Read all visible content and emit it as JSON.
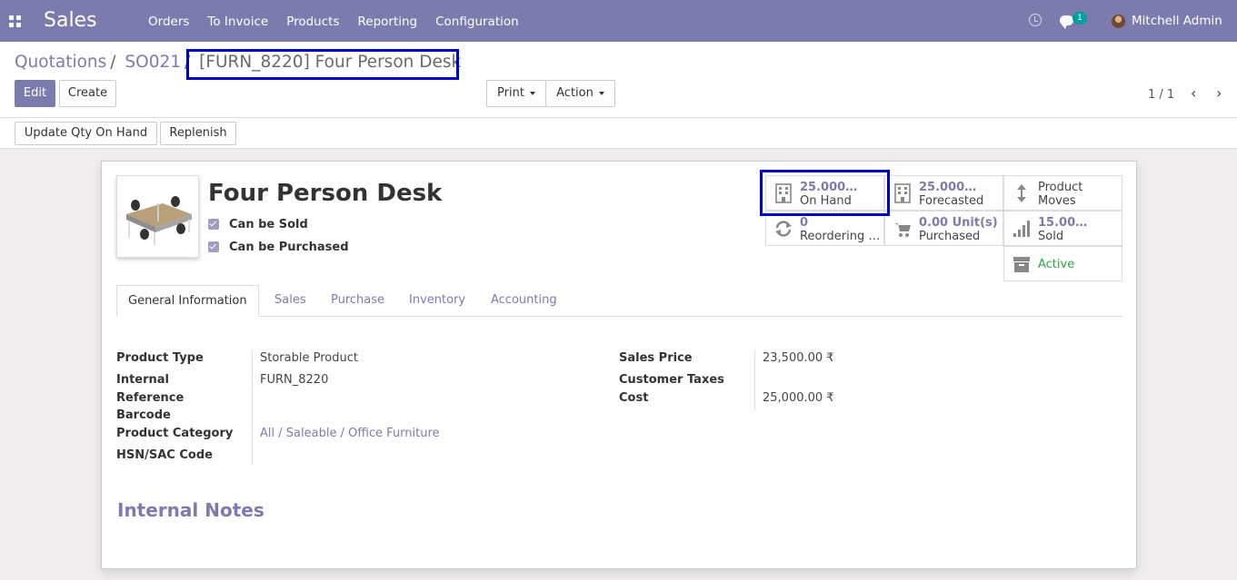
{
  "navbar": {
    "app_name": "Sales",
    "menu": [
      "Orders",
      "To Invoice",
      "Products",
      "Reporting",
      "Configuration"
    ],
    "chat_badge": "1",
    "user": "Mitchell Admin",
    "bg_color": "#7c7bad"
  },
  "breadcrumb": {
    "items": [
      "Quotations",
      "SO021"
    ],
    "current": "[FURN_8220] Four Person Desk"
  },
  "toolbar": {
    "edit_label": "Edit",
    "create_label": "Create",
    "print_label": "Print",
    "action_label": "Action",
    "pager": "1 / 1"
  },
  "statusbar": {
    "update_qty_label": "Update Qty On Hand",
    "replenish_label": "Replenish"
  },
  "product": {
    "name": "Four Person Desk",
    "can_be_sold_label": "Can be Sold",
    "can_be_purchased_label": "Can be Purchased",
    "can_be_sold": true,
    "can_be_purchased": true
  },
  "smart_buttons": {
    "on_hand": {
      "value": "25.000…",
      "label": "On Hand"
    },
    "forecasted": {
      "value": "25.000…",
      "label": "Forecasted"
    },
    "moves": {
      "line1": "Product",
      "line2": "Moves"
    },
    "reordering": {
      "value": "0",
      "label": "Reordering …"
    },
    "purchased": {
      "value": "0.00 Unit(s)",
      "label": "Purchased"
    },
    "sold": {
      "value": "15.00…",
      "label": "Sold"
    },
    "active": {
      "label": "Active"
    }
  },
  "tabs": [
    "General Information",
    "Sales",
    "Purchase",
    "Inventory",
    "Accounting"
  ],
  "general": {
    "product_type_label": "Product Type",
    "product_type": "Storable Product",
    "internal_ref_label_1": "Internal",
    "internal_ref_label_2": "Reference",
    "internal_ref": "FURN_8220",
    "barcode_label": "Barcode",
    "category_label": "Product Category",
    "category": [
      "All",
      "Saleable",
      "Office Furniture"
    ],
    "hsn_label": "HSN/SAC Code",
    "sales_price_label": "Sales Price",
    "sales_price": "23,500.00 ₹",
    "customer_taxes_label": "Customer Taxes",
    "cost_label": "Cost",
    "cost": "25,000.00 ₹"
  },
  "notes_label": "Internal Notes"
}
